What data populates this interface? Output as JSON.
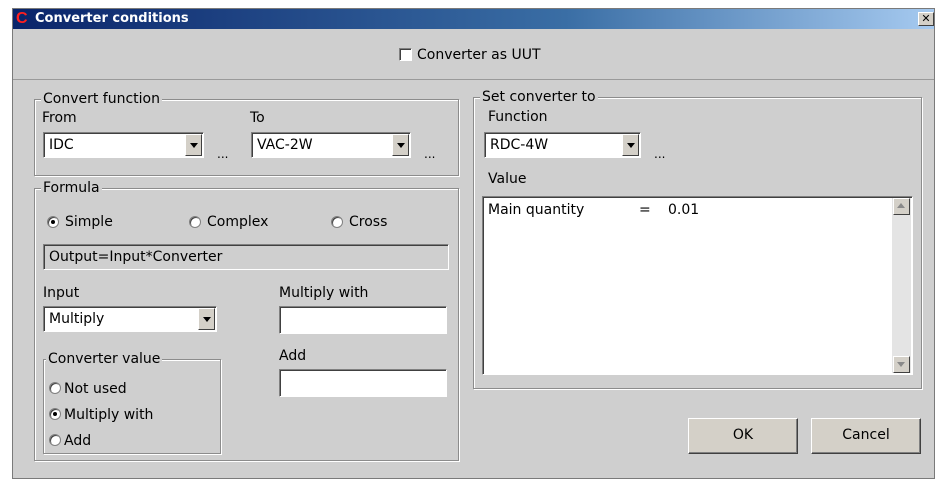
{
  "window": {
    "title": "Converter conditions",
    "close_glyph": "✕",
    "app_icon": "C"
  },
  "uut_checkbox": {
    "label": "Converter as UUT",
    "checked": false
  },
  "convert_function": {
    "legend": "Convert function",
    "from_label": "From",
    "from_value": "IDC",
    "to_label": "To",
    "to_value": "VAC-2W",
    "ellipsis": "..."
  },
  "formula": {
    "legend": "Formula",
    "options": [
      {
        "label": "Simple",
        "checked": true
      },
      {
        "label": "Complex",
        "checked": false
      },
      {
        "label": "Cross",
        "checked": false
      }
    ],
    "expression": "Output=Input*Converter",
    "input_label": "Input",
    "input_value": "Multiply",
    "multiply_label": "Multiply with",
    "multiply_value": "",
    "add_label": "Add",
    "add_value": "",
    "converter_value": {
      "legend": "Converter value",
      "options": [
        {
          "label": "Not used",
          "checked": false
        },
        {
          "label": "Multiply with",
          "checked": true
        },
        {
          "label": "Add",
          "checked": false
        }
      ]
    }
  },
  "set_converter": {
    "legend": "Set converter to",
    "function_label": "Function",
    "function_value": "RDC-4W",
    "ellipsis": "...",
    "value_label": "Value",
    "rows": [
      {
        "name": "Main quantity",
        "eq": "=",
        "value": "0.01"
      }
    ]
  },
  "buttons": {
    "ok": "OK",
    "cancel": "Cancel"
  },
  "colors": {
    "title_start": "#0a246a",
    "dialog_bg": "#cfcfcf",
    "app_icon": "#ff2020"
  },
  "icons": {
    "app": "converter-app-icon",
    "close": "close-icon",
    "dropdown": "chevron-down-icon",
    "scroll_up": "scroll-up-arrow-icon",
    "scroll_down": "scroll-down-arrow-icon"
  }
}
